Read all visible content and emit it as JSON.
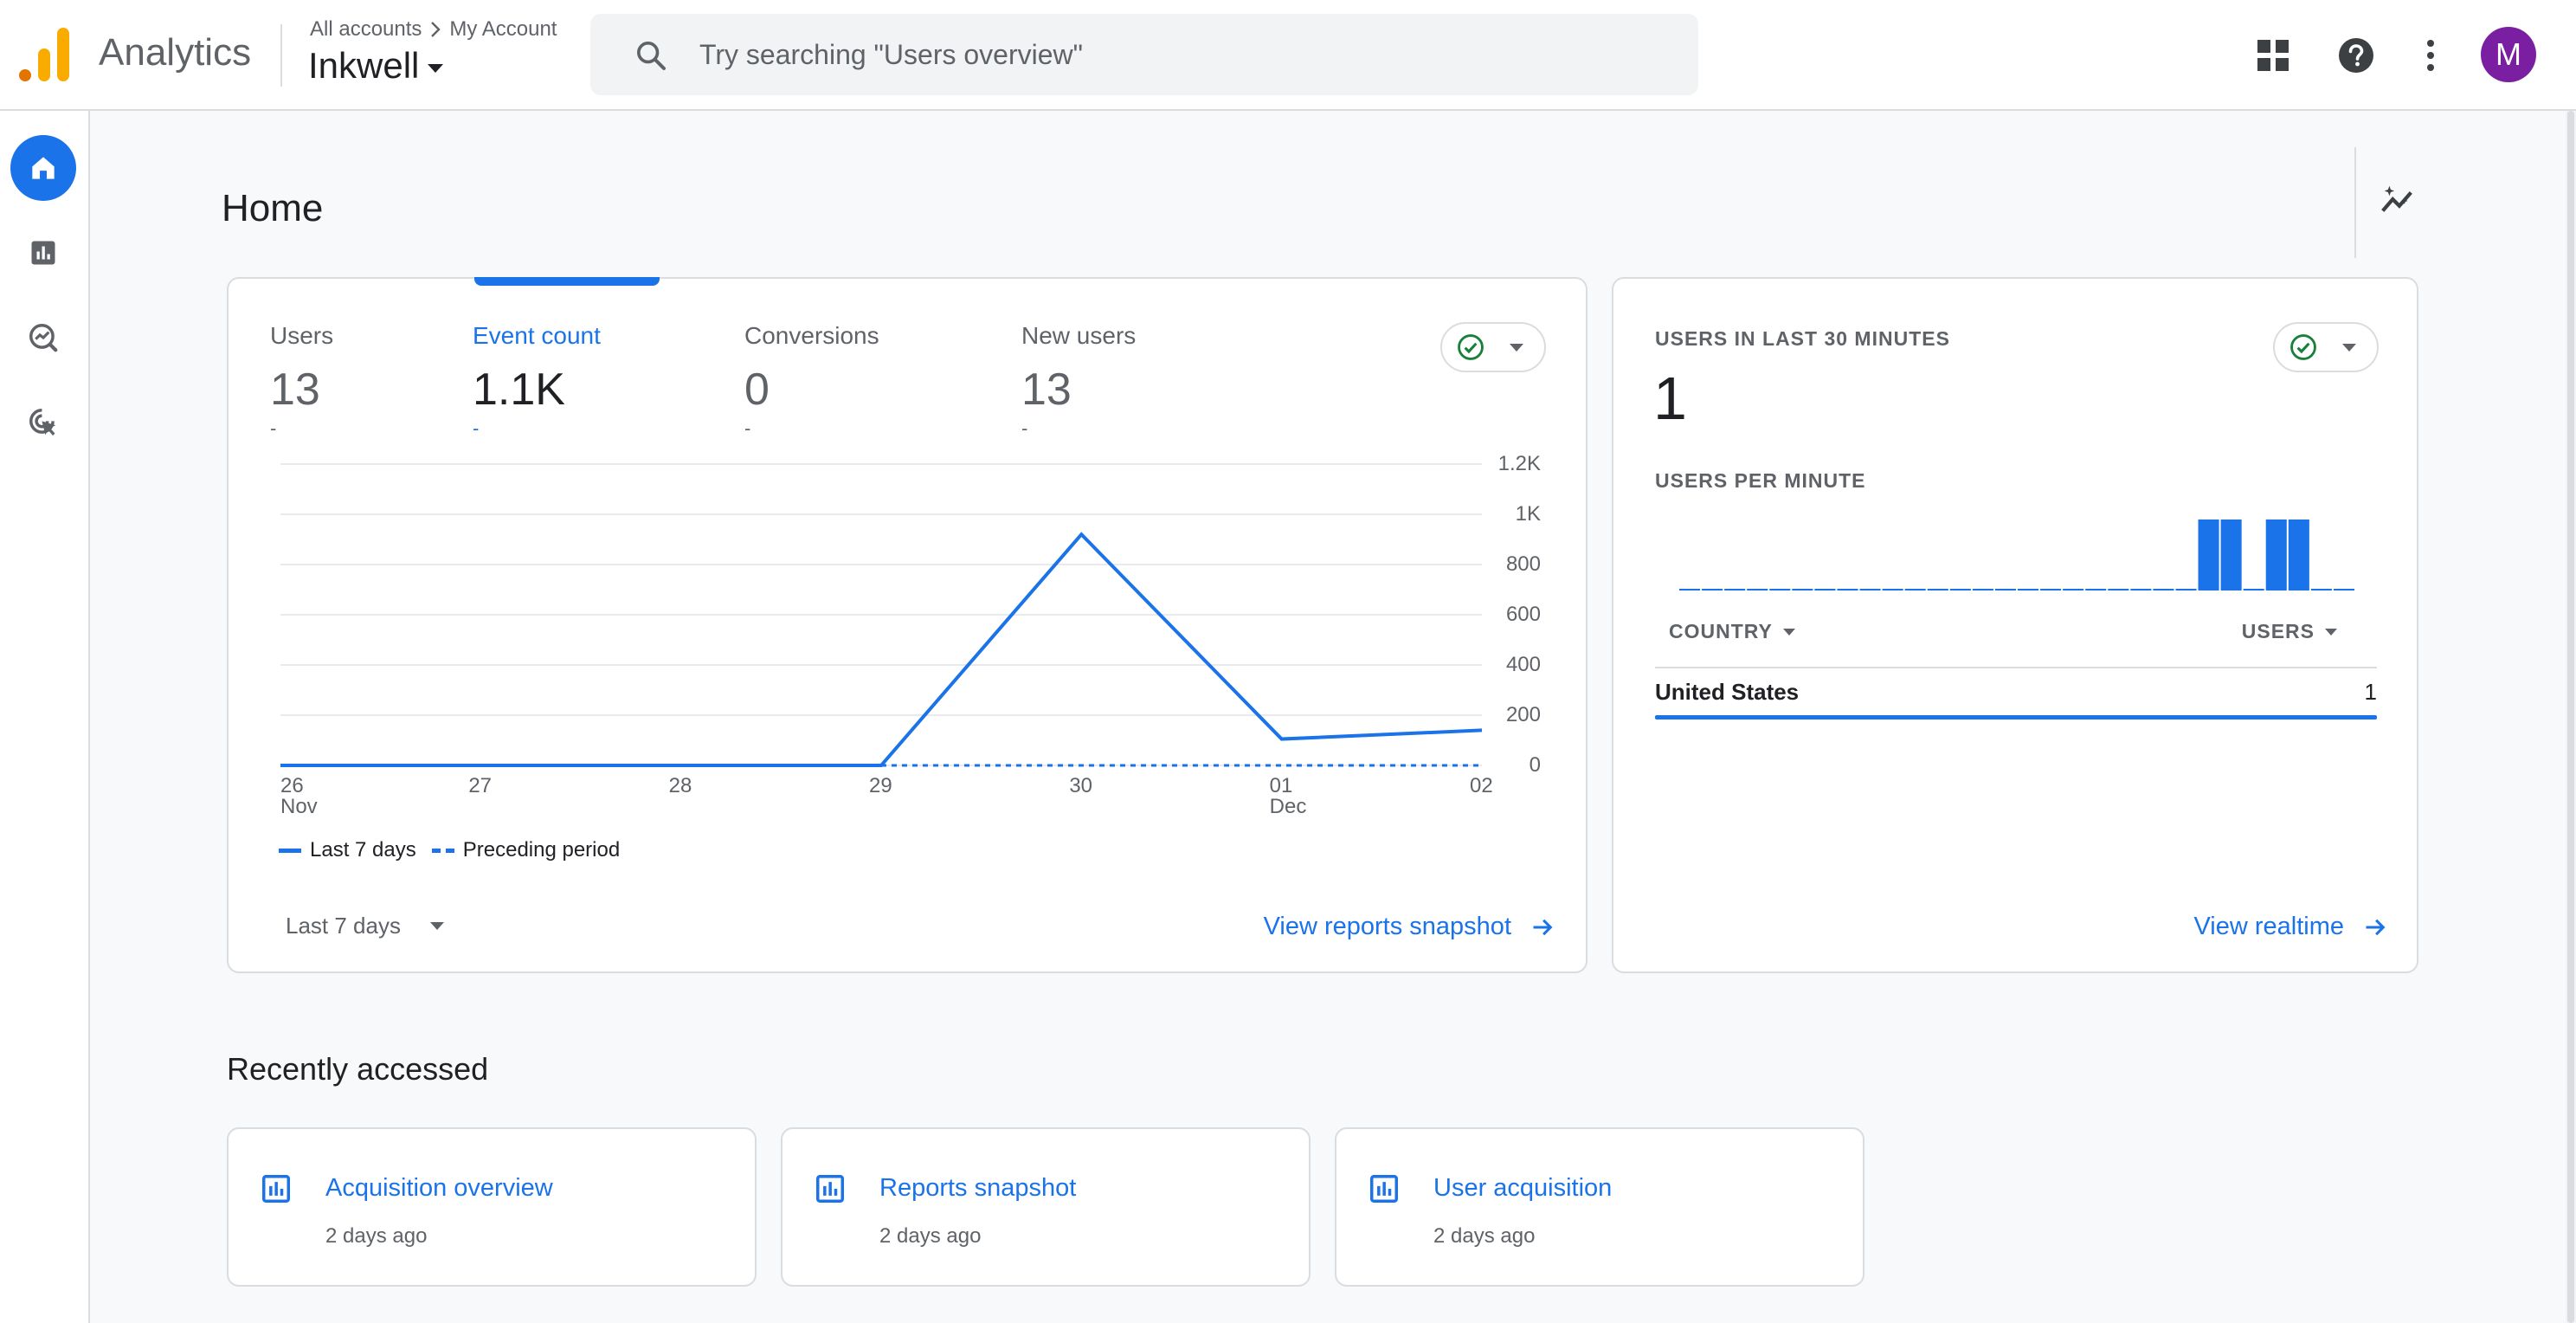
{
  "header": {
    "app_name": "Analytics",
    "breadcrumb_root": "All accounts",
    "breadcrumb_account": "My Account",
    "property_name": "Inkwell",
    "search_placeholder": "Try searching \"Users overview\"",
    "avatar_initial": "M"
  },
  "page": {
    "title": "Home"
  },
  "overview_card": {
    "tabs": [
      {
        "label": "Users",
        "value": "13",
        "change": "-"
      },
      {
        "label": "Event count",
        "value": "1.1K",
        "change": "-",
        "selected": true
      },
      {
        "label": "Conversions",
        "value": "0",
        "change": "-"
      },
      {
        "label": "New users",
        "value": "13",
        "change": "-"
      }
    ],
    "legend": {
      "current": "Last 7 days",
      "previous": "Preceding period"
    },
    "date_range": "Last 7 days",
    "link": "View reports snapshot"
  },
  "chart_data": {
    "type": "line",
    "metric": "Event count",
    "x": [
      "26",
      "27",
      "28",
      "29",
      "30",
      "01",
      "02"
    ],
    "x_sublabels": [
      "Nov",
      "",
      "",
      "",
      "",
      "Dec",
      ""
    ],
    "series": [
      {
        "name": "Last 7 days",
        "values": [
          0,
          0,
          0,
          0,
          920,
          105,
          140
        ],
        "style": "solid"
      },
      {
        "name": "Preceding period",
        "values": [
          null,
          null,
          null,
          0,
          0,
          0,
          0
        ],
        "style": "dashed"
      }
    ],
    "y_ticks": [
      "0",
      "200",
      "400",
      "600",
      "800",
      "1K",
      "1.2K"
    ],
    "ylim": [
      0,
      1200
    ],
    "grid": true,
    "color": "#1a73e8"
  },
  "realtime_card": {
    "title": "USERS IN LAST 30 MINUTES",
    "value": "1",
    "per_minute_label": "USERS PER MINUTE",
    "per_minute": [
      0,
      0,
      0,
      0,
      0,
      0,
      0,
      0,
      0,
      0,
      0,
      0,
      0,
      0,
      0,
      0,
      0,
      0,
      0,
      0,
      0,
      0,
      0,
      1,
      1,
      0,
      1,
      1,
      0,
      0
    ],
    "col_country": "COUNTRY",
    "col_users": "USERS",
    "rows": [
      {
        "country": "United States",
        "users": "1"
      }
    ],
    "link": "View realtime"
  },
  "recent": {
    "title": "Recently accessed",
    "items": [
      {
        "name": "Acquisition overview",
        "when": "2 days ago"
      },
      {
        "name": "Reports snapshot",
        "when": "2 days ago"
      },
      {
        "name": "User acquisition",
        "when": "2 days ago"
      }
    ]
  },
  "colors": {
    "accent": "#1a73e8",
    "status_ok": "#188038",
    "avatar": "#7b1fa2",
    "logo_orange": "#f9ab00",
    "logo_dark_orange": "#e37400"
  }
}
